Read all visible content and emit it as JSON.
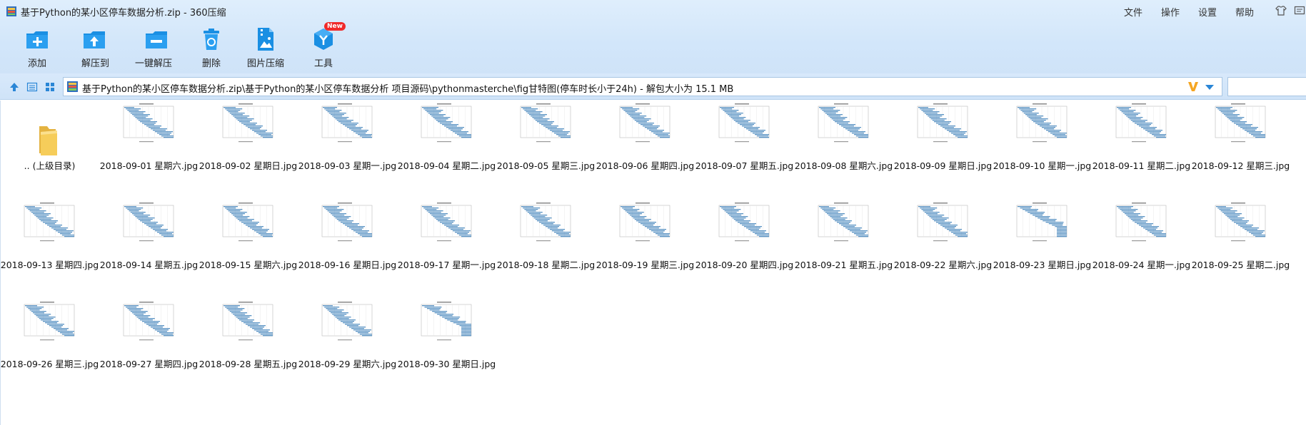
{
  "window": {
    "title": "基于Python的某小区停车数据分析.zip - 360压缩",
    "menu": [
      "文件",
      "操作",
      "设置",
      "帮助"
    ]
  },
  "toolbar": {
    "buttons": [
      {
        "label": "添加",
        "icon": "add-icon"
      },
      {
        "label": "解压到",
        "icon": "extract-to-icon"
      },
      {
        "label": "一键解压",
        "icon": "one-click-extract-icon"
      },
      {
        "label": "删除",
        "icon": "delete-icon"
      },
      {
        "label": "图片压缩",
        "icon": "image-compress-icon"
      },
      {
        "label": "工具",
        "icon": "tools-icon"
      }
    ],
    "badge": "New"
  },
  "address": {
    "path": "基于Python的某小区停车数据分析.zip\\基于Python的某小区停车数据分析 项目源码\\pythonmasterche\\fig甘特图(停车时长小于24h) - 解包大小为 15.1 MB"
  },
  "files": {
    "parent": ".. (上级目录)",
    "items": [
      "2018-09-01 星期六.jpg",
      "2018-09-02 星期日.jpg",
      "2018-09-03 星期一.jpg",
      "2018-09-04 星期二.jpg",
      "2018-09-05 星期三.jpg",
      "2018-09-06 星期四.jpg",
      "2018-09-07 星期五.jpg",
      "2018-09-08 星期六.jpg",
      "2018-09-09 星期日.jpg",
      "2018-09-10 星期一.jpg",
      "2018-09-11 星期二.jpg",
      "2018-09-12 星期三.jpg",
      "2018-09-13 星期四.jpg",
      "2018-09-14 星期五.jpg",
      "2018-09-15 星期六.jpg",
      "2018-09-16 星期日.jpg",
      "2018-09-17 星期一.jpg",
      "2018-09-18 星期二.jpg",
      "2018-09-19 星期三.jpg",
      "2018-09-20 星期四.jpg",
      "2018-09-21 星期五.jpg",
      "2018-09-22 星期六.jpg",
      "2018-09-23 星期日.jpg",
      "2018-09-24 星期一.jpg",
      "2018-09-25 星期二.jpg",
      "2018-09-26 星期三.jpg",
      "2018-09-27 星期四.jpg",
      "2018-09-28 星期五.jpg",
      "2018-09-29 星期六.jpg",
      "2018-09-30 星期日.jpg"
    ]
  },
  "colors": {
    "toolbar_bg": "#d2e6fa",
    "icon_blue": "#1a8fe3",
    "badge_red": "#f02a2a",
    "chart_blue": "#3c7fb8",
    "folder_yellow": "#f6cd5a"
  }
}
